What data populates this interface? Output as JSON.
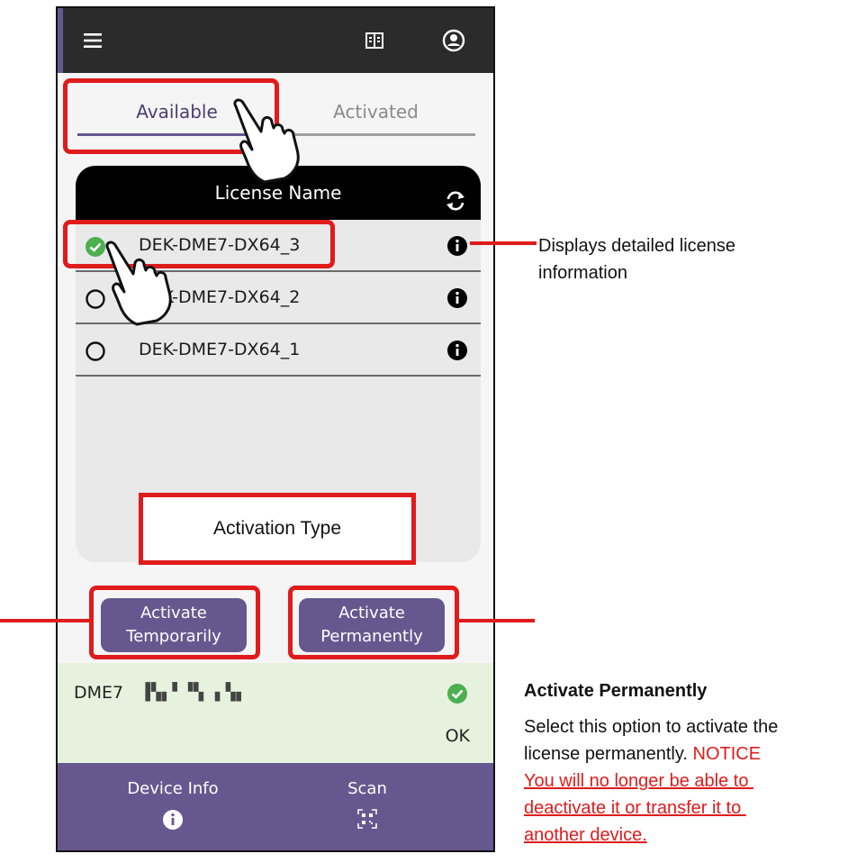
{
  "header": {
    "menu_icon": "hamburger-menu-icon",
    "building_icon": "building-icon",
    "account_icon": "account-circle-icon"
  },
  "tabs": [
    {
      "label": "Available",
      "active": true
    },
    {
      "label": "Activated",
      "active": false
    }
  ],
  "license_table": {
    "header": "License Name",
    "refresh_icon": "refresh-icon",
    "rows": [
      {
        "name": "DEK-DME7-DX64_3",
        "selected": true
      },
      {
        "name": "DEK-DME7-DX64_2",
        "selected": false
      },
      {
        "name": "DEK-DME7-DX64_1",
        "selected": false
      }
    ]
  },
  "activation_type_label": "Activation Type",
  "buttons": {
    "temporary": [
      "Activate",
      "Temporarily"
    ],
    "permanent": [
      "Activate",
      "Permanently"
    ]
  },
  "status": {
    "device": "DME7",
    "serial": "▐▚▖▘▝▚ ▖▚▖",
    "result": "OK"
  },
  "bottom_nav": [
    {
      "label": "Device Info",
      "icon": "info-icon"
    },
    {
      "label": "Scan",
      "icon": "qr-scan-icon"
    }
  ],
  "annotations": {
    "info_callout": [
      "Displays detailed license",
      "information"
    ],
    "permanent_title": "Activate Permanently",
    "permanent_desc": [
      "Select this option to activate the",
      "license permanently."
    ],
    "notice_label": "NOTICE",
    "notice_text": [
      "You will no longer be able to ",
      "deactivate it or transfer it to ",
      "another device."
    ]
  },
  "colors": {
    "accent": "#66588f",
    "annotation_red": "#e01b1b",
    "check_green": "#4caf50",
    "status_bg": "#e6f2dd"
  }
}
